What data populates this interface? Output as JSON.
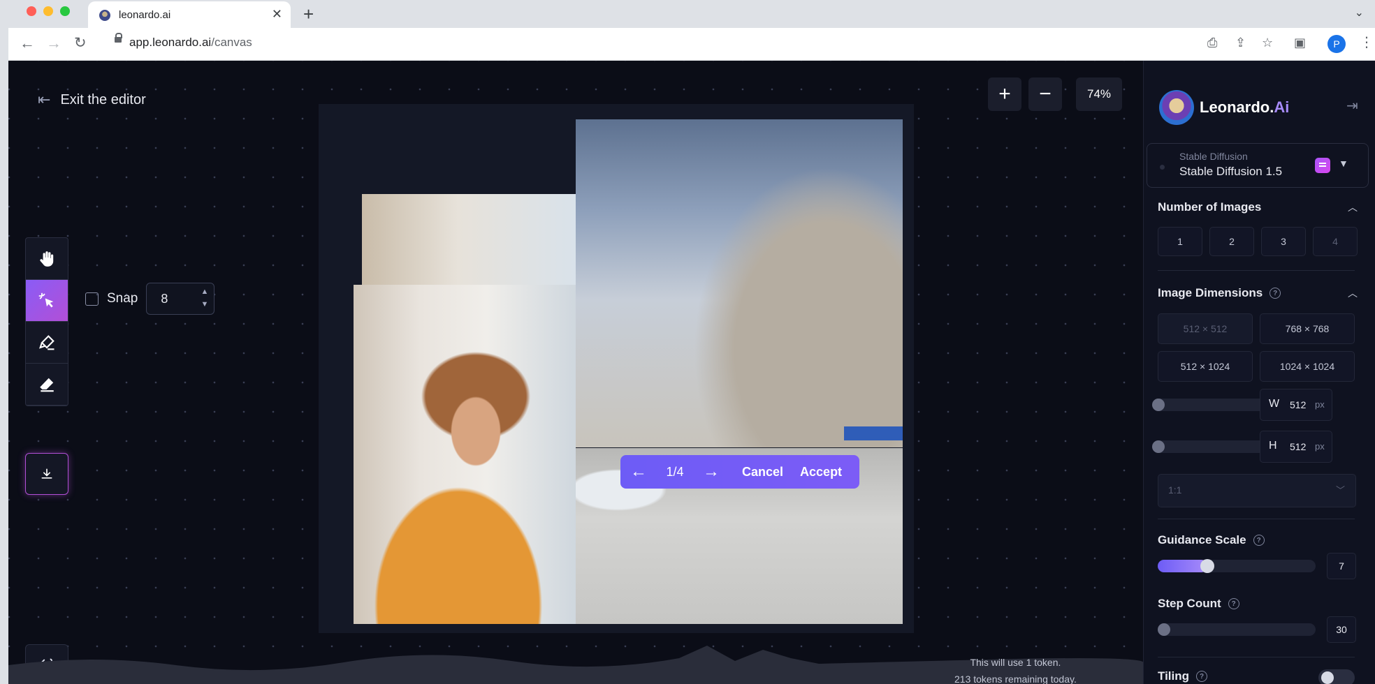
{
  "browser": {
    "tab_title": "leonardo.ai",
    "url_host": "app.leonardo.ai",
    "url_path": "/canvas",
    "profile_initial": "P"
  },
  "editor": {
    "exit_label": "Exit the editor",
    "zoom": "74%",
    "zoom_in": "+",
    "zoom_out": "−",
    "snap_label": "Snap",
    "snap_value": "8",
    "pagination": "1/4",
    "cancel_label": "Cancel",
    "accept_label": "Accept",
    "token_line1": "This will use 1 token.",
    "token_line2": "213 tokens remaining today."
  },
  "tools": [
    {
      "name": "hand-tool",
      "icon": "hand-icon"
    },
    {
      "name": "select-tool",
      "icon": "pointer-sparkle-icon",
      "active": true
    },
    {
      "name": "draw-mask-tool",
      "icon": "brush-icon"
    },
    {
      "name": "eraser-tool",
      "icon": "eraser-icon"
    },
    {
      "name": "image-upload-tool",
      "icon": "image-icon"
    }
  ],
  "panel": {
    "brand_prefix": "Leonardo.",
    "brand_suffix": "Ai",
    "model_label": "Stable Diffusion",
    "model_value": "Stable Diffusion 1.5",
    "num_images_title": "Number of Images",
    "num_images": [
      "1",
      "2",
      "3",
      "4"
    ],
    "dimensions_title": "Image Dimensions",
    "dimensions": [
      "512 × 512",
      "768 × 768",
      "512 × 1024",
      "1024 × 1024"
    ],
    "width_label": "W",
    "width_value": "512",
    "height_label": "H",
    "height_value": "512",
    "unit": "px",
    "aspect_ratio": "1:1",
    "guidance_title": "Guidance Scale",
    "guidance_value": "7",
    "guidance_fraction": 0.27,
    "step_title": "Step Count",
    "step_value": "30",
    "tiling_title": "Tiling"
  },
  "colors": {
    "accent": "#7c5cf6",
    "background": "#0b0d17",
    "panel": "#0f1220"
  }
}
